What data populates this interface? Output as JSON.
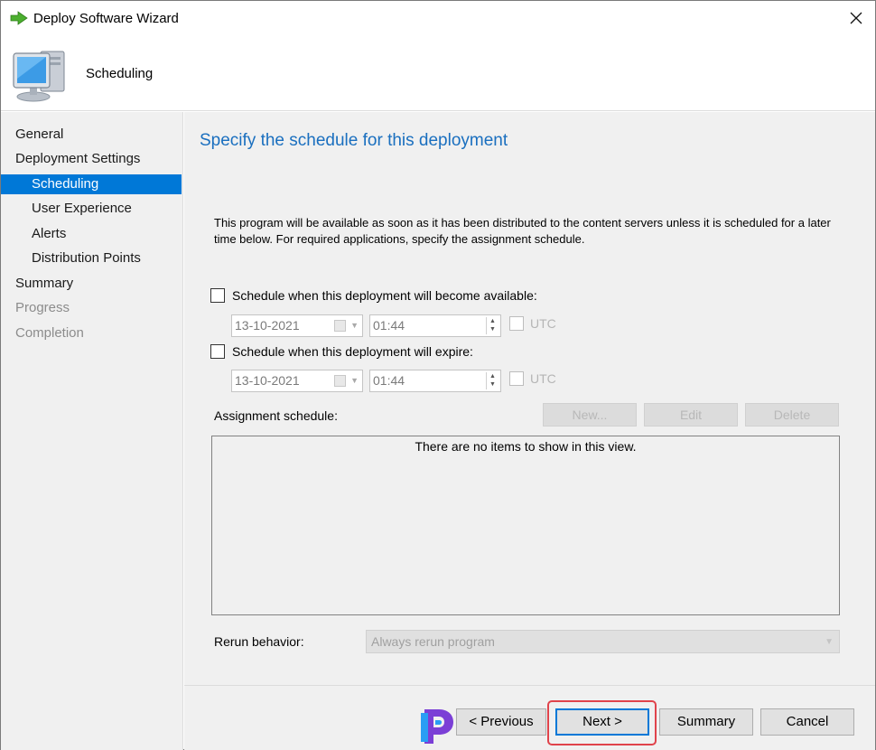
{
  "window": {
    "title": "Deploy Software Wizard"
  },
  "header": {
    "title": "Scheduling"
  },
  "nav": {
    "items": [
      {
        "label": "General",
        "level": "top",
        "state": "normal"
      },
      {
        "label": "Deployment Settings",
        "level": "top",
        "state": "normal"
      },
      {
        "label": "Scheduling",
        "level": "sub",
        "state": "active"
      },
      {
        "label": "User Experience",
        "level": "sub",
        "state": "normal"
      },
      {
        "label": "Alerts",
        "level": "sub",
        "state": "normal"
      },
      {
        "label": "Distribution Points",
        "level": "sub",
        "state": "normal"
      },
      {
        "label": "Summary",
        "level": "top",
        "state": "normal"
      },
      {
        "label": "Progress",
        "level": "top",
        "state": "disabled"
      },
      {
        "label": "Completion",
        "level": "top",
        "state": "disabled"
      }
    ]
  },
  "main": {
    "page_title": "Specify the schedule for this deployment",
    "description": "This program will be available as soon as it has been distributed to the content servers unless it is scheduled for a later time below. For required applications, specify the assignment schedule.",
    "available": {
      "label": "Schedule when this deployment will become available:",
      "checked": false,
      "date": "13-10-2021",
      "time": "01:44",
      "utc_label": "UTC"
    },
    "expire": {
      "label": "Schedule when this deployment will expire:",
      "checked": false,
      "date": "13-10-2021",
      "time": "01:44",
      "utc_label": "UTC"
    },
    "assignment": {
      "label": "Assignment schedule:",
      "new_label": "New...",
      "edit_label": "Edit",
      "delete_label": "Delete",
      "empty_message": "There are no items to show in this view."
    },
    "rerun": {
      "label": "Rerun behavior:",
      "value": "Always rerun program"
    }
  },
  "footer": {
    "previous_label": "< Previous",
    "next_label": "Next >",
    "summary_label": "Summary",
    "cancel_label": "Cancel"
  },
  "colors": {
    "accent": "#0078d7",
    "title_blue": "#1a6fbf",
    "highlight": "#e0434b",
    "panel": "#f0f0f0"
  }
}
